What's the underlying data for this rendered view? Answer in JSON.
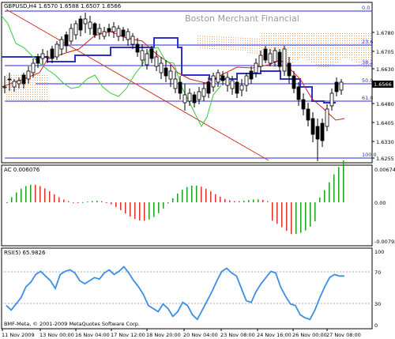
{
  "main": {
    "symbol_line": "GBPUSD,H4  1.6570 1.6588 1.6507 1.6566",
    "watermark": "Boston Merchant Financial",
    "current_price": "1.6566",
    "price_axis": [
      "1.6780",
      "1.6705",
      "1.6630",
      "1.6555",
      "1.6480",
      "1.6405",
      "1.6330",
      "1.6255"
    ],
    "fib_levels": [
      "0.0",
      "23.6",
      "38.2",
      "50.0",
      "61.8",
      "100.0"
    ]
  },
  "ac": {
    "label": "AC 0.006076",
    "axis": [
      "0.00674",
      "0.00",
      "-0.00792"
    ]
  },
  "rsi": {
    "label": "RSI(5) 65.9826",
    "axis": [
      "100",
      "70",
      "30",
      "0"
    ],
    "copyright": "BMF-Meta, © 2001-2009 MetaQuotes Software Corp."
  },
  "time_axis": [
    "11 Nov 2009",
    "13 Nov 00:00",
    "16 Nov 04:00",
    "17 Nov 12:00",
    "18 Nov 20:00",
    "20 Nov 04:00",
    "23 Nov 08:00",
    "24 Nov 16:00",
    "26 Nov 00:00",
    "27 Nov 08:00"
  ],
  "colors": {
    "bull": "#1f9e1f",
    "bear": "#e0302a",
    "rsi": "#3b8ee6",
    "fib": "#2a2ae0",
    "kijun": "#3030d0",
    "tenkan": "#d02020",
    "chikou": "#33cc33"
  }
}
